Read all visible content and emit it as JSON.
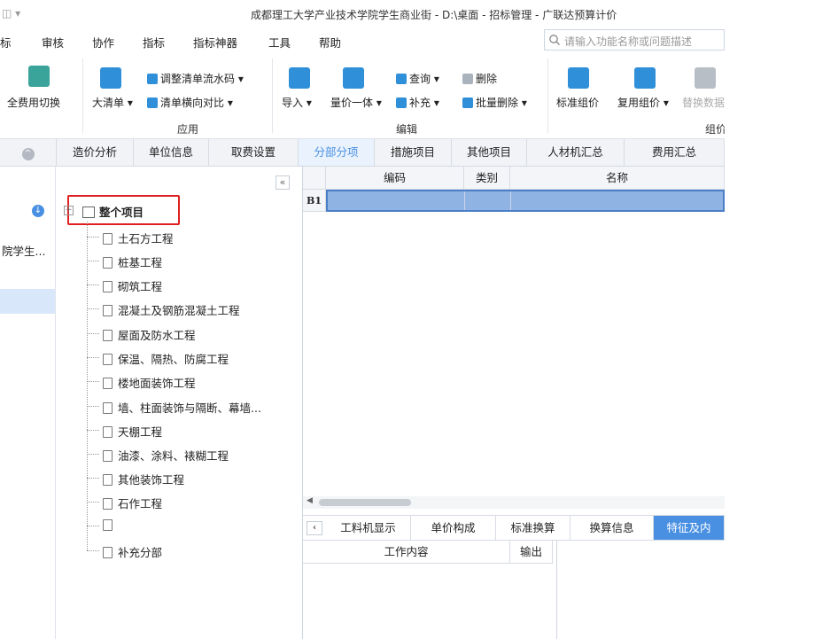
{
  "title": "成都理工大学产业技术学院学生商业街 - D:\\桌面 - 招标管理 - 广联达预算计价",
  "menu": [
    "标",
    "审核",
    "协作",
    "指标",
    "指标神器",
    "工具",
    "帮助"
  ],
  "search": {
    "placeholder": "请输入功能名称或问题描述"
  },
  "ribbon": {
    "full_fee_switch": "全费用切换",
    "big_list": "大清单",
    "adjust_flow": "调整清单流水码",
    "compare": "清单横向对比",
    "group_app": "应用",
    "import": "导入",
    "price_integrated": "量价一体",
    "query": "查询",
    "supplement": "补充",
    "delete": "删除",
    "batch_delete": "批量删除",
    "group_edit": "编辑",
    "std_group_price": "标准组价",
    "reuse_group_price": "复用组价",
    "replace_data": "替换数据",
    "group_cut": "组价"
  },
  "tabs": [
    "造价分析",
    "单位信息",
    "取费设置",
    "分部分项",
    "措施项目",
    "其他项目",
    "人材机汇总",
    "费用汇总"
  ],
  "active_tab": "分部分项",
  "left_panel": {
    "project_name": "院学生..."
  },
  "tree": {
    "root": "整个项目",
    "children": [
      "土石方工程",
      "桩基工程",
      "砌筑工程",
      "混凝土及钢筋混凝土工程",
      "屋面及防水工程",
      "保温、隔热、防腐工程",
      "楼地面装饰工程",
      "墙、柱面装饰与隔断、幕墙...",
      "天棚工程",
      "油漆、涂料、裱糊工程",
      "其他装饰工程",
      "石作工程",
      "",
      "补充分部"
    ]
  },
  "grid": {
    "headers": [
      "编码",
      "类别",
      "名称"
    ],
    "row_label": "B1"
  },
  "lower_tabs": [
    "工料机显示",
    "单价构成",
    "标准换算",
    "换算信息",
    "特征及内"
  ],
  "lower_active": "特征及内",
  "lower_grid": {
    "headers": [
      "工作内容",
      "输出"
    ]
  },
  "colors": {
    "accent": "#4a90e2",
    "highlight_border": "#e02020",
    "selected_row": "#8fb3e3"
  }
}
